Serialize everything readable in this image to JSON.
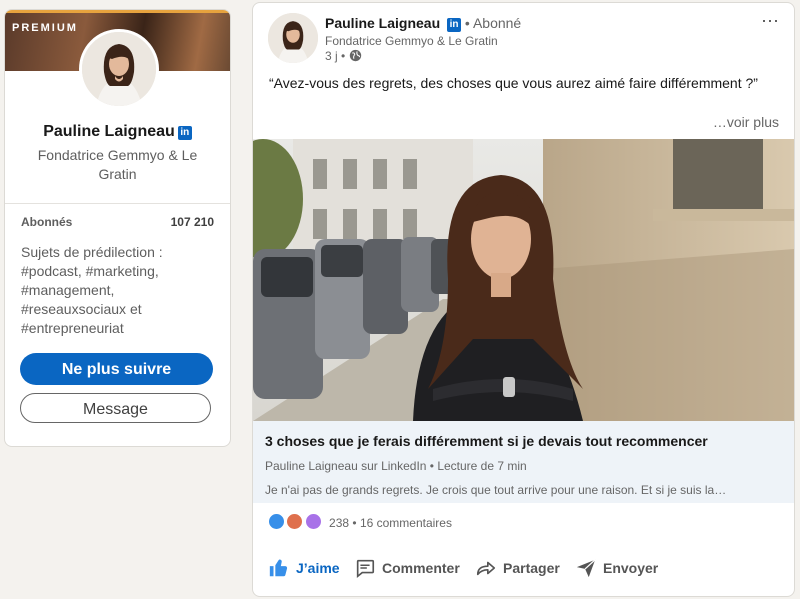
{
  "profile": {
    "badge": "PREMIUM",
    "name": "Pauline Laigneau",
    "linkedin_badge": "in",
    "headline": "Fondatrice Gemmyo & Le Gratin",
    "followers_label": "Abonnés",
    "followers_count": "107 210",
    "topics": "Sujets de prédilection : #podcast, #marketing, #management, #reseauxsociaux et #entrepreneuriat",
    "unfollow_label": "Ne plus suivre",
    "message_label": "Message"
  },
  "post": {
    "author": "Pauline Laigneau",
    "linkedin_badge": "in",
    "follow_state": "• Abonné",
    "author_subtitle": "Fondatrice Gemmyo & Le Gratin",
    "time": "3 j •",
    "more_icon": "⋯",
    "text": "“Avez-vous des regrets, des choses que vous aurez aimé faire différemment ?”",
    "see_more": "…voir plus",
    "article": {
      "title": "3 choses que je ferais différemment si je devais tout recommencer",
      "meta": "Pauline Laigneau sur LinkedIn • Lecture de 7 min",
      "description": "Je n'ai pas de grands regrets. Je crois que tout arrive pour une raison. Et si je suis la…"
    },
    "reactions_count": "238",
    "comments_count": "• 16 commentaires",
    "actions": {
      "like": "J’aime",
      "comment": "Commenter",
      "share": "Partager",
      "send": "Envoyer"
    }
  },
  "colors": {
    "accent": "#0a66c2",
    "premium_bar": "#e7a33e",
    "like_reaction": "#378fe9",
    "love_reaction": "#df704d",
    "curious_reaction": "#a872e8"
  }
}
